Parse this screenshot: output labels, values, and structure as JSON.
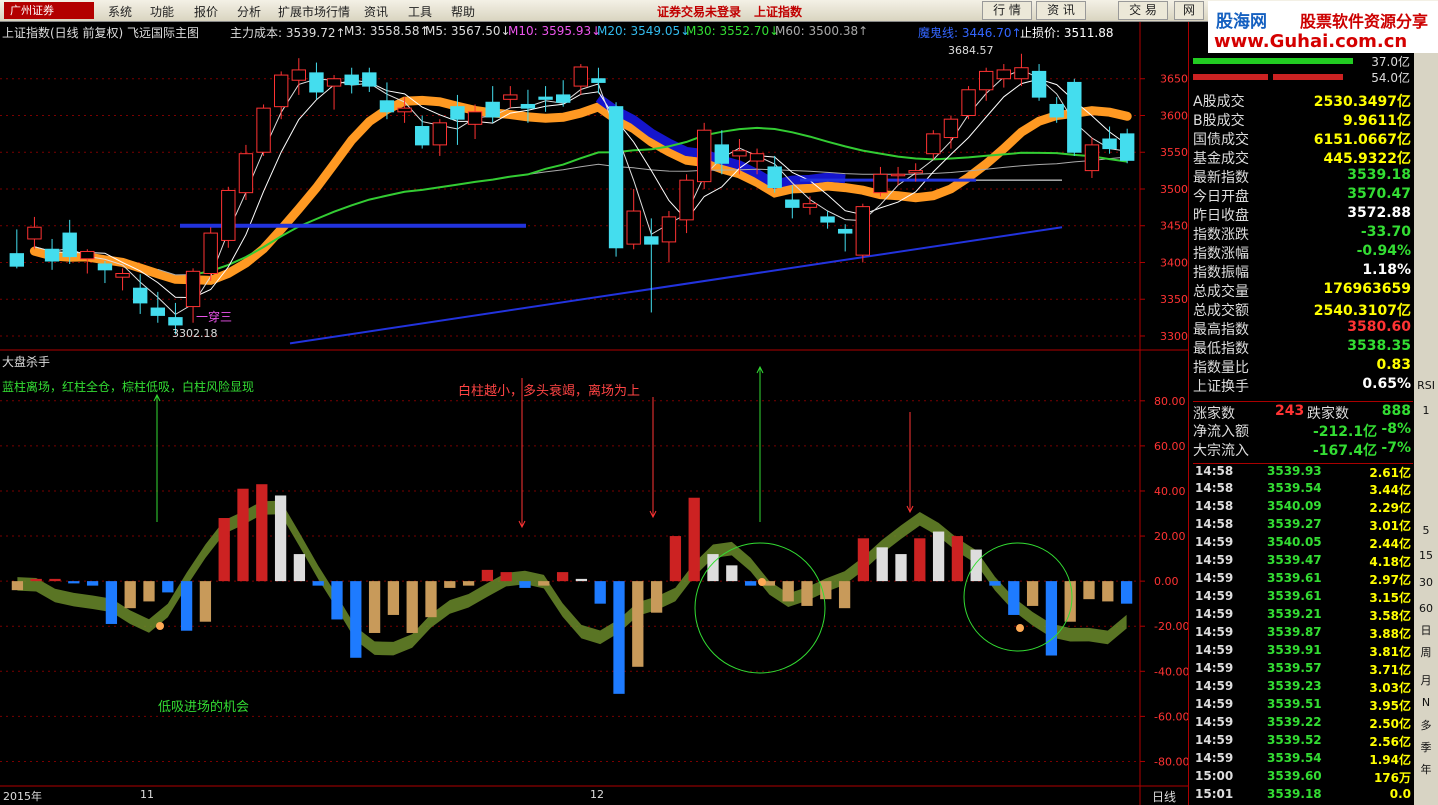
{
  "menubar": {
    "logo": "广州证券",
    "items": [
      "系统",
      "功能",
      "报价",
      "分析",
      "扩展市场行情",
      "资讯",
      "工具",
      "帮助"
    ],
    "center_left": "证券交易未登录",
    "center_right": "上证指数",
    "right_buttons": [
      "行  情",
      "资  讯",
      "交  易",
      "网"
    ]
  },
  "watermark": {
    "site": "股海网",
    "slogan": "股票软件资源分享",
    "url": "www.Guhai.com.cn"
  },
  "main_chart": {
    "header": {
      "title": "上证指数(日线 前复权) 飞远国际主图",
      "cost": "主力成本: 3539.72↑",
      "m3": "M3: 3558.58↑",
      "m5": "M5: 3567.50↓",
      "m10": "M10: 3595.93↓",
      "m20": "M20: 3549.05↓",
      "m30": "M30: 3552.70↓",
      "m60": "M60: 3500.38↑",
      "trap": "魔鬼线: 3446.70↑",
      "stop": "止损价: 3511.88"
    },
    "y_ticks": [
      "3650",
      "3600",
      "3550",
      "3500",
      "3450",
      "3400",
      "3350",
      "3300"
    ],
    "annotations": {
      "high": "3684.57",
      "low": "3302.18",
      "pattern": "一穿三"
    }
  },
  "indicator": {
    "title": "大盘杀手",
    "legend": "蓝柱离场，红柱全仓，棕柱低吸，白柱风险显现",
    "note_top": "白柱越小，多头衰竭，离场为上",
    "note_bottom": "低吸进场的机会",
    "y_ticks": [
      "80.00",
      "60.00",
      "40.00",
      "20.00",
      "0.00",
      "-20.00",
      "-40.00",
      "-60.00",
      "-80.00"
    ]
  },
  "x_axis": {
    "labels": [
      "2015年",
      "11",
      "12"
    ],
    "period": "日线"
  },
  "side_panel": {
    "header_values": [
      "37.0亿",
      "54.0亿"
    ],
    "stats": [
      {
        "k": "A股成交",
        "v": "2530.3497亿",
        "c": "#ffff00"
      },
      {
        "k": "B股成交",
        "v": "9.9611亿",
        "c": "#ffff00"
      },
      {
        "k": "国债成交",
        "v": "6151.0667亿",
        "c": "#ffff00"
      },
      {
        "k": "基金成交",
        "v": "445.9322亿",
        "c": "#ffff00"
      },
      {
        "k": "最新指数",
        "v": "3539.18",
        "c": "#33dd33"
      },
      {
        "k": "今日开盘",
        "v": "3570.47",
        "c": "#33dd33"
      },
      {
        "k": "昨日收盘",
        "v": "3572.88",
        "c": "#ffffff"
      },
      {
        "k": "指数涨跌",
        "v": "-33.70",
        "c": "#33dd33"
      },
      {
        "k": "指数涨幅",
        "v": "-0.94%",
        "c": "#33dd33"
      },
      {
        "k": "指数振幅",
        "v": "1.18%",
        "c": "#ffffff"
      },
      {
        "k": "总成交量",
        "v": "176963659",
        "c": "#ffff00"
      },
      {
        "k": "总成交额",
        "v": "2540.3107亿",
        "c": "#ffff00"
      },
      {
        "k": "最高指数",
        "v": "3580.60",
        "c": "#ff3333"
      },
      {
        "k": "最低指数",
        "v": "3538.35",
        "c": "#33dd33"
      },
      {
        "k": "指数量比",
        "v": "0.83",
        "c": "#ffff00"
      },
      {
        "k": "上证换手",
        "v": "0.65%",
        "c": "#ffffff"
      }
    ],
    "updown": {
      "up_label": "涨家数",
      "up": "243",
      "down_label": "跌家数",
      "down": "888"
    },
    "flows": [
      {
        "k": "净流入额",
        "v": "-212.1亿",
        "p": "-8%"
      },
      {
        "k": "大宗流入",
        "v": "-167.4亿",
        "p": "-7%"
      }
    ],
    "trades": [
      {
        "t": "14:58",
        "p": "3539.93",
        "v": "2.61亿"
      },
      {
        "t": "14:58",
        "p": "3539.54",
        "v": "3.44亿"
      },
      {
        "t": "14:58",
        "p": "3540.09",
        "v": "2.29亿"
      },
      {
        "t": "14:58",
        "p": "3539.27",
        "v": "3.01亿"
      },
      {
        "t": "14:59",
        "p": "3540.05",
        "v": "2.44亿"
      },
      {
        "t": "14:59",
        "p": "3539.47",
        "v": "4.18亿"
      },
      {
        "t": "14:59",
        "p": "3539.61",
        "v": "2.97亿"
      },
      {
        "t": "14:59",
        "p": "3539.61",
        "v": "3.15亿"
      },
      {
        "t": "14:59",
        "p": "3539.21",
        "v": "3.58亿"
      },
      {
        "t": "14:59",
        "p": "3539.87",
        "v": "3.88亿"
      },
      {
        "t": "14:59",
        "p": "3539.91",
        "v": "3.81亿"
      },
      {
        "t": "14:59",
        "p": "3539.57",
        "v": "3.71亿"
      },
      {
        "t": "14:59",
        "p": "3539.23",
        "v": "3.03亿"
      },
      {
        "t": "14:59",
        "p": "3539.51",
        "v": "3.95亿"
      },
      {
        "t": "14:59",
        "p": "3539.22",
        "v": "2.50亿"
      },
      {
        "t": "14:59",
        "p": "3539.52",
        "v": "2.56亿"
      },
      {
        "t": "14:59",
        "p": "3539.54",
        "v": "1.94亿"
      },
      {
        "t": "15:00",
        "p": "3539.60",
        "v": "176万"
      },
      {
        "t": "15:01",
        "p": "3539.18",
        "v": "0.0"
      }
    ]
  },
  "toolbar": [
    "RSI",
    "1",
    "5",
    "15",
    "30",
    "60",
    "日",
    "周",
    "月",
    "N",
    "多",
    "季",
    "年"
  ],
  "chart_data": [
    {
      "type": "candlestick",
      "title": "上证指数(日线 前复权)",
      "ylim": [
        3285,
        3700
      ],
      "candles": [
        [
          3412,
          3445,
          3392,
          3395
        ],
        [
          3432,
          3462,
          3418,
          3448
        ],
        [
          3418,
          3432,
          3390,
          3402
        ],
        [
          3440,
          3458,
          3398,
          3408
        ],
        [
          3405,
          3418,
          3385,
          3415
        ],
        [
          3398,
          3402,
          3372,
          3390
        ],
        [
          3380,
          3392,
          3362,
          3385
        ],
        [
          3365,
          3384,
          3330,
          3345
        ],
        [
          3338,
          3360,
          3318,
          3328
        ],
        [
          3325,
          3345,
          3302,
          3315
        ],
        [
          3340,
          3392,
          3318,
          3388
        ],
        [
          3385,
          3448,
          3375,
          3440
        ],
        [
          3430,
          3503,
          3420,
          3498
        ],
        [
          3495,
          3560,
          3485,
          3548
        ],
        [
          3550,
          3615,
          3545,
          3610
        ],
        [
          3612,
          3660,
          3595,
          3655
        ],
        [
          3648,
          3678,
          3628,
          3662
        ],
        [
          3658,
          3672,
          3622,
          3632
        ],
        [
          3640,
          3655,
          3608,
          3650
        ],
        [
          3655,
          3665,
          3630,
          3642
        ],
        [
          3658,
          3665,
          3632,
          3640
        ],
        [
          3620,
          3645,
          3595,
          3605
        ],
        [
          3605,
          3625,
          3590,
          3610
        ],
        [
          3585,
          3600,
          3555,
          3560
        ],
        [
          3560,
          3595,
          3545,
          3590
        ],
        [
          3612,
          3628,
          3560,
          3595
        ],
        [
          3588,
          3615,
          3568,
          3605
        ],
        [
          3618,
          3640,
          3590,
          3598
        ],
        [
          3622,
          3640,
          3610,
          3628
        ],
        [
          3615,
          3635,
          3590,
          3610
        ],
        [
          3625,
          3640,
          3605,
          3622
        ],
        [
          3628,
          3648,
          3612,
          3618
        ],
        [
          3640,
          3670,
          3628,
          3666
        ],
        [
          3650,
          3665,
          3630,
          3645
        ],
        [
          3612,
          3618,
          3408,
          3420
        ],
        [
          3425,
          3500,
          3418,
          3470
        ],
        [
          3435,
          3460,
          3332,
          3425
        ],
        [
          3428,
          3470,
          3400,
          3462
        ],
        [
          3458,
          3520,
          3440,
          3512
        ],
        [
          3510,
          3590,
          3500,
          3580
        ],
        [
          3560,
          3580,
          3520,
          3535
        ],
        [
          3545,
          3568,
          3520,
          3552
        ],
        [
          3538,
          3555,
          3520,
          3548
        ],
        [
          3530,
          3545,
          3495,
          3502
        ],
        [
          3485,
          3505,
          3460,
          3475
        ],
        [
          3475,
          3490,
          3465,
          3480
        ],
        [
          3462,
          3470,
          3446,
          3455
        ],
        [
          3445,
          3452,
          3415,
          3440
        ],
        [
          3410,
          3480,
          3400,
          3476
        ],
        [
          3495,
          3530,
          3490,
          3520
        ],
        [
          3518,
          3530,
          3505,
          3520
        ],
        [
          3522,
          3535,
          3510,
          3525
        ],
        [
          3548,
          3580,
          3540,
          3575
        ],
        [
          3570,
          3600,
          3555,
          3595
        ],
        [
          3600,
          3640,
          3595,
          3635
        ],
        [
          3635,
          3665,
          3620,
          3660
        ],
        [
          3650,
          3670,
          3638,
          3662
        ],
        [
          3650,
          3684,
          3640,
          3665
        ],
        [
          3660,
          3670,
          3620,
          3625
        ],
        [
          3615,
          3625,
          3590,
          3598
        ],
        [
          3645,
          3650,
          3545,
          3550
        ],
        [
          3525,
          3570,
          3515,
          3560
        ],
        [
          3568,
          3585,
          3548,
          3555
        ],
        [
          3575,
          3582,
          3535,
          3539
        ]
      ]
    },
    {
      "type": "bar",
      "title": "大盘杀手",
      "ylim": [
        -90,
        95
      ],
      "values": [
        -4,
        1,
        1,
        -1,
        -2,
        -19,
        -12,
        -9,
        -5,
        -22,
        -18,
        28,
        41,
        43,
        38,
        12,
        -2,
        -17,
        -34,
        -23,
        -15,
        -23,
        -16,
        -3,
        -2,
        5,
        4,
        -3,
        -2,
        4,
        1,
        -10,
        -50,
        -38,
        -14,
        20,
        37,
        12,
        7,
        -2,
        -2,
        -9,
        -11,
        -8,
        -12,
        19,
        15,
        12,
        19,
        22,
        20,
        14,
        -2,
        -15,
        -11,
        -33,
        -18,
        -8,
        -9,
        -10
      ],
      "colors": [
        "tan",
        "red",
        "red",
        "blue",
        "blue",
        "blue",
        "tan",
        "tan",
        "blue",
        "blue",
        "tan",
        "red",
        "red",
        "red",
        "white",
        "white",
        "blue",
        "blue",
        "blue",
        "tan",
        "tan",
        "tan",
        "tan",
        "tan",
        "tan",
        "red",
        "red",
        "blue",
        "tan",
        "red",
        "white",
        "blue",
        "blue",
        "tan",
        "tan",
        "red",
        "red",
        "white",
        "white",
        "blue",
        "tan",
        "tan",
        "tan",
        "tan",
        "tan",
        "red",
        "white",
        "white",
        "red",
        "white",
        "red",
        "white",
        "blue",
        "blue",
        "tan",
        "blue",
        "tan",
        "tan",
        "tan",
        "blue"
      ]
    }
  ]
}
